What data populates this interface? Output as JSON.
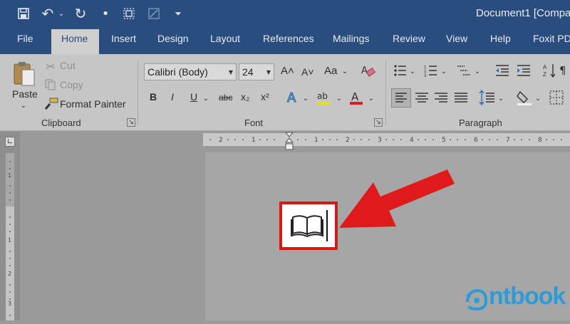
{
  "title_bar": {
    "document_title": "Document1 [Compat",
    "quick_access": [
      {
        "name": "save-icon",
        "glyph": "🖫"
      },
      {
        "name": "undo-icon",
        "glyph": "↶"
      },
      {
        "name": "redo-icon",
        "glyph": "↻"
      },
      {
        "name": "bullet-dot-icon",
        "glyph": "•"
      },
      {
        "name": "select-object-icon",
        "glyph": "⛶"
      },
      {
        "name": "format-icon",
        "glyph": "⊠"
      },
      {
        "name": "customize-icon",
        "glyph": "⏷"
      }
    ]
  },
  "tabs": [
    "File",
    "Home",
    "Insert",
    "Design",
    "Layout",
    "References",
    "Mailings",
    "Review",
    "View",
    "Help",
    "Foxit PD"
  ],
  "active_tab": "Home",
  "clipboard": {
    "paste": "Paste",
    "cut": "Cut",
    "copy": "Copy",
    "format_painter": "Format Painter",
    "label": "Clipboard"
  },
  "font": {
    "family": "Calibri (Body)",
    "size": "24",
    "label": "Font",
    "bold": "B",
    "italic": "I",
    "underline": "U",
    "strikethrough": "abc",
    "subscript": "x₂",
    "superscript": "x²",
    "grow": "A˄",
    "shrink": "A˅",
    "change_case": "Aa",
    "highlight": "ab",
    "font_color": "A"
  },
  "paragraph": {
    "label": "Paragraph"
  },
  "document": {
    "inserted_symbol": "open-book-icon"
  },
  "watermark": {
    "text": "ntbook"
  },
  "colors": {
    "title_bar": "#2a4d7f",
    "ribbon": "#c6c6c6",
    "highlight_box": "#d81818",
    "arrow": "#e01a1a",
    "watermark": "#2e9bd6"
  }
}
